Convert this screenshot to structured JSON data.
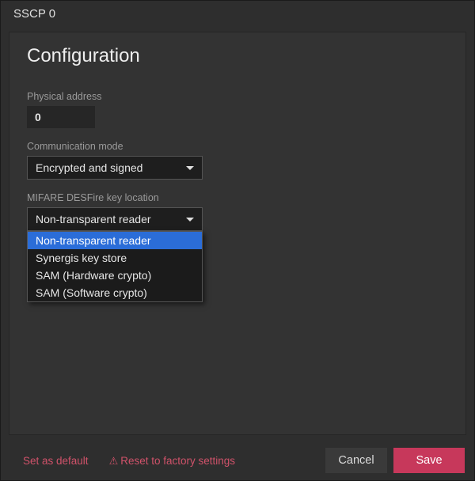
{
  "window": {
    "title": "SSCP 0"
  },
  "panel": {
    "heading": "Configuration"
  },
  "fields": {
    "physical_address": {
      "label": "Physical address",
      "value": "0"
    },
    "communication_mode": {
      "label": "Communication mode",
      "selected": "Encrypted and signed"
    },
    "key_location": {
      "label": "MIFARE DESFire key location",
      "selected": "Non-transparent reader",
      "options": [
        "Non-transparent reader",
        "Synergis key store",
        "SAM (Hardware crypto)",
        "SAM (Software crypto)"
      ],
      "highlighted_index": 0
    }
  },
  "footer": {
    "set_default": "Set as default",
    "reset": "Reset to factory settings",
    "cancel": "Cancel",
    "save": "Save"
  },
  "colors": {
    "accent": "#c7385b",
    "link": "#d0526a",
    "highlight": "#2b6dd8"
  }
}
